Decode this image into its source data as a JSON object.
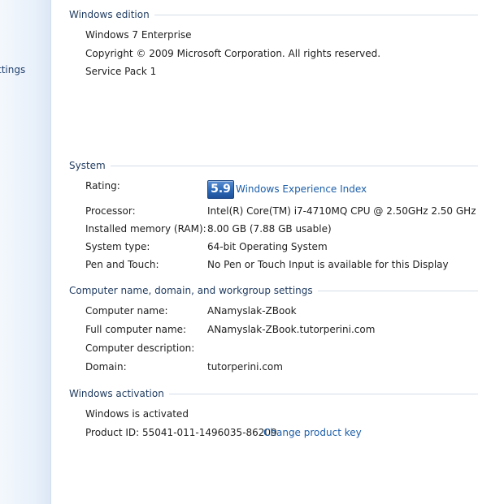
{
  "sidebar": {
    "link_label": "ttings"
  },
  "windows_edition": {
    "title": "Windows edition",
    "edition": "Windows 7 Enterprise",
    "copyright": "Copyright © 2009 Microsoft Corporation.  All rights reserved.",
    "service_pack": "Service Pack 1"
  },
  "system": {
    "title": "System",
    "rating_label": "Rating:",
    "rating_score": "5.9",
    "rating_link": "Windows Experience Index",
    "processor_label": "Processor:",
    "processor_value": "Intel(R) Core(TM) i7-4710MQ CPU @ 2.50GHz   2.50 GHz",
    "memory_label": "Installed memory (RAM):",
    "memory_value": "8.00 GB (7.88 GB usable)",
    "type_label": "System type:",
    "type_value": "64-bit Operating System",
    "pen_label": "Pen and Touch:",
    "pen_value": "No Pen or Touch Input is available for this Display"
  },
  "computer_name": {
    "title": "Computer name, domain, and workgroup settings",
    "name_label": "Computer name:",
    "name_value": "ANamyslak-ZBook",
    "full_label": "Full computer name:",
    "full_value": "ANamyslak-ZBook.tutorperini.com",
    "desc_label": "Computer description:",
    "desc_value": "",
    "domain_label": "Domain:",
    "domain_value": "tutorperini.com"
  },
  "activation": {
    "title": "Windows activation",
    "status": "Windows is activated",
    "product_id": "Product ID:  55041-011-1496035-86209",
    "change_key_link": "Change product key"
  },
  "colors": {
    "link": "#1c5ea8",
    "section_title": "#1e3a5f",
    "badge": "#2f6bb8",
    "sidebar": "#e8f0fa"
  }
}
